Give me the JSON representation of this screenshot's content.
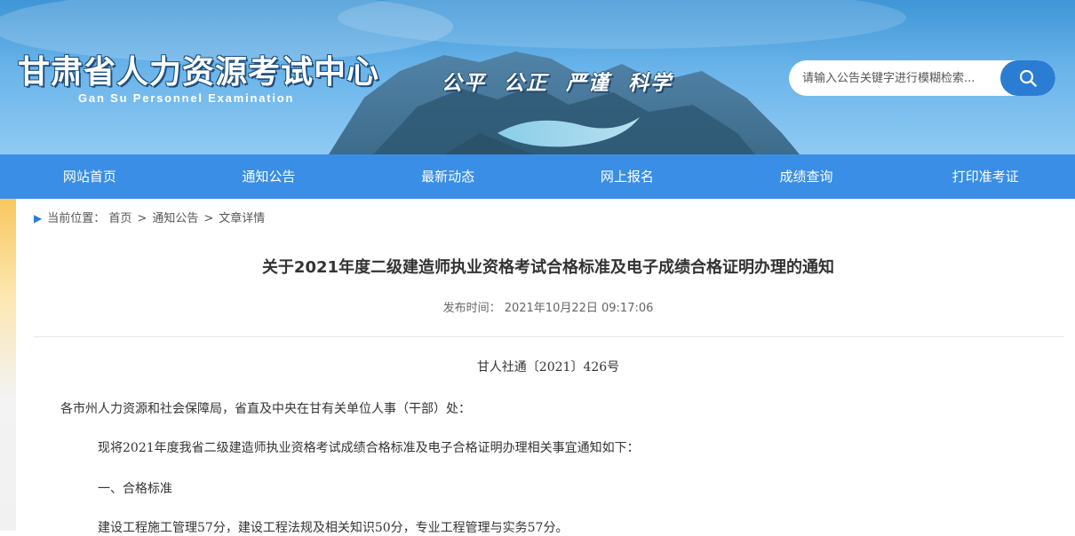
{
  "header": {
    "site_title": "甘肃省人力资源考试中心",
    "site_subtitle": "Gan Su Personnel Examination",
    "motto": "公平  公正  严谨  科学",
    "search_placeholder": "请输入公告关键字进行模糊检索...",
    "search_icon": "search-icon"
  },
  "nav": {
    "items": [
      {
        "label": "网站首页"
      },
      {
        "label": "通知公告"
      },
      {
        "label": "最新动态"
      },
      {
        "label": "网上报名"
      },
      {
        "label": "成绩查询"
      },
      {
        "label": "打印准考证"
      }
    ]
  },
  "breadcrumb": {
    "prefix": "当前位置：",
    "home": "首页",
    "separator": ">",
    "section": "通知公告",
    "current": "文章详情"
  },
  "article": {
    "title": "关于2021年度二级建造师执业资格考试合格标准及电子成绩合格证明办理的通知",
    "publish_info": "发布时间： 2021年10月22日 09:17:06",
    "doc_number": "甘人社通〔2021〕426号",
    "salutation": "各市州人力资源和社会保障局，省直及中央在甘有关单位人事（干部）处：",
    "intro": "现将2021年度我省二级建造师执业资格考试成绩合格标准及电子合格证明办理相关事宜通知如下：",
    "section_heading": "一、合格标准",
    "standards": "建设工程施工管理57分，建设工程法规及相关知识50分，专业工程管理与实务57分。"
  },
  "colors": {
    "nav_background": "#3a8ee6",
    "search_button": "#2a7dd2",
    "breadcrumb_arrow": "#2a7dd2"
  }
}
